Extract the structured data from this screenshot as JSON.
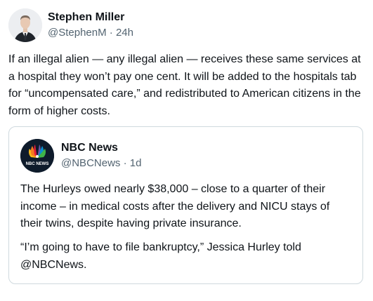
{
  "post": {
    "author": {
      "display_name": "Stephen Miller",
      "handle": "@StephenM",
      "separator": "·",
      "time": "24h"
    },
    "text": "If an illegal alien — any illegal alien — receives these same services at a hospital they won’t pay one cent. It will be added to the hospitals tab for “uncompensated care,” and redistributed to American citizens in the form of higher costs."
  },
  "quote": {
    "author": {
      "display_name": "NBC News",
      "handle": "@NBCNews",
      "separator": "·",
      "time": "1d",
      "avatar_text": "NBC NEWS"
    },
    "paragraph1": "The Hurleys owed nearly $38,000 – close to a quarter of their income – in medical costs after the delivery and NICU stays of their twins, despite having private insurance.",
    "paragraph2": "“I’m going to have to file bankruptcy,” Jessica Hurley told @NBCNews."
  },
  "colors": {
    "text": "#0f1419",
    "muted": "#536471",
    "border": "#cfd9de",
    "nbc_bg": "#0e1b2b"
  },
  "icons": {
    "author_avatar": "person-portrait-icon",
    "quote_avatar": "nbc-peacock-logo-icon"
  }
}
